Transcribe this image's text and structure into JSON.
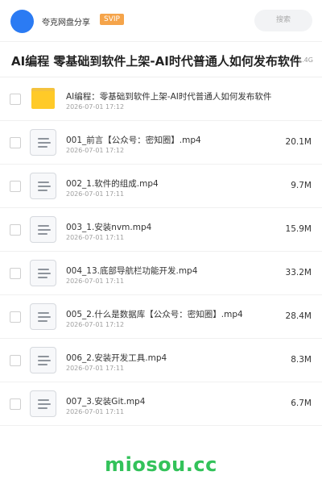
{
  "header": {
    "user_name": "夸克网盘分享",
    "badge": "SVIP",
    "search_placeholder": "搜索"
  },
  "folder": {
    "title": "AI编程 零基础到软件上架-AI时代普通人如何发布软件",
    "size": "1.4G"
  },
  "files": [
    {
      "name": "AI编程：零基础到软件上架-AI时代普通人如何发布软件",
      "date": "2026-07-01 17:12",
      "size": "",
      "icon": "folder-icon"
    },
    {
      "name": "001_前言【公众号：密知圈】.mp4",
      "date": "2026-07-01 17:12",
      "size": "20.1M",
      "icon": "video-file-icon"
    },
    {
      "name": "002_1.软件的组成.mp4",
      "date": "2026-07-01 17:11",
      "size": "9.7M",
      "icon": "video-file-icon"
    },
    {
      "name": "003_1.安装nvm.mp4",
      "date": "2026-07-01 17:11",
      "size": "15.9M",
      "icon": "video-file-icon"
    },
    {
      "name": "004_13.底部导航栏功能开发.mp4",
      "date": "2026-07-01 17:11",
      "size": "33.2M",
      "icon": "video-file-icon"
    },
    {
      "name": "005_2.什么是数据库【公众号：密知圈】.mp4",
      "date": "2026-07-01 17:12",
      "size": "28.4M",
      "icon": "video-file-icon"
    },
    {
      "name": "006_2.安装开发工具.mp4",
      "date": "2026-07-01 17:11",
      "size": "8.3M",
      "icon": "video-file-icon"
    },
    {
      "name": "007_3.安装Git.mp4",
      "date": "2026-07-01 17:11",
      "size": "6.7M",
      "icon": "video-file-icon"
    }
  ],
  "watermark": "miosou.cc",
  "colors": {
    "avatar": "#2b7bf3",
    "badge": "#f5a44a",
    "folder": "#ffca28",
    "watermark": "#33c25a"
  }
}
